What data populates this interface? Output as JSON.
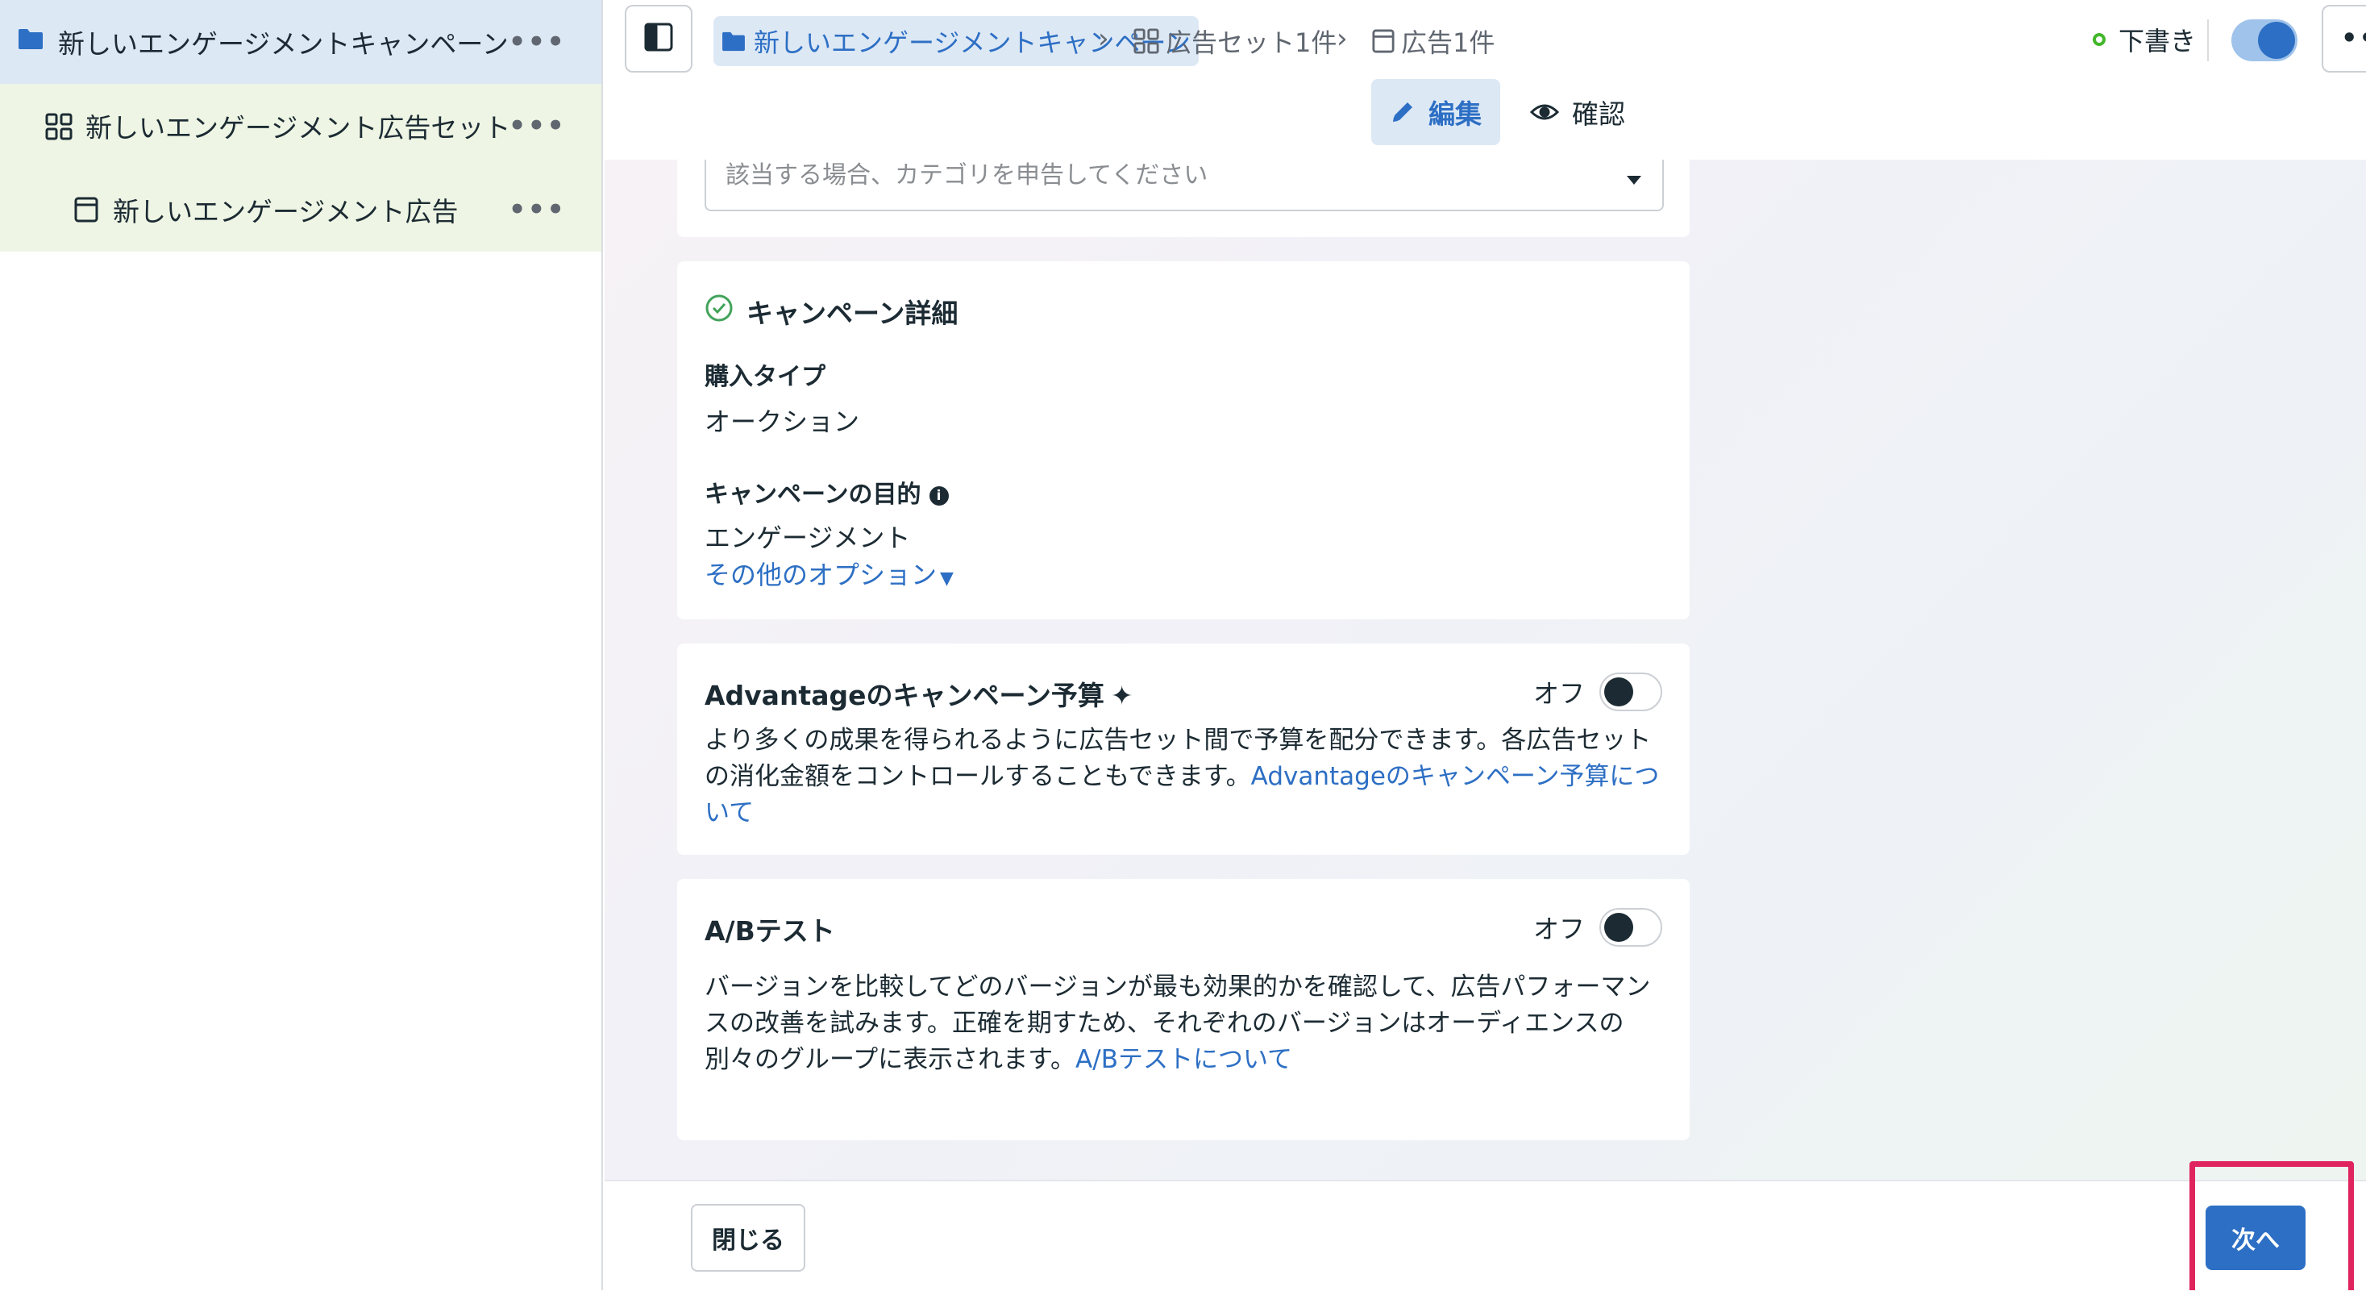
{
  "sidebar": {
    "items": [
      {
        "label": "新しいエンゲージメントキャンペーン",
        "icon": "folder-icon",
        "more": "•••"
      },
      {
        "label": "新しいエンゲージメント広告セット",
        "icon": "grid-icon",
        "more": "•••"
      },
      {
        "label": "新しいエンゲージメント広告",
        "icon": "ad-icon",
        "more": "•••"
      }
    ]
  },
  "header": {
    "breadcrumb": {
      "campaign": "新しいエンゲージメントキャンペーン",
      "adset": "広告セット1件",
      "ad": "広告1件",
      "separator": "›"
    },
    "status": "下書き",
    "more": "•••",
    "tabs": {
      "edit": "編集",
      "review": "確認"
    }
  },
  "main": {
    "category_dropdown": {
      "placeholder": "該当する場合、カテゴリを申告してください"
    },
    "campaign_details": {
      "title": "キャンペーン詳細",
      "purchase_type_label": "購入タイプ",
      "purchase_type_value": "オークション",
      "objective_label": "キャンペーンの目的",
      "objective_value": "エンゲージメント",
      "more_options": "その他のオプション"
    },
    "advantage_budget": {
      "title": "Advantageのキャンペーン予算",
      "toggle_label": "オフ",
      "description": "より多くの成果を得られるように広告セット間で予算を配分できます。各広告セットの消化金額をコントロールすることもできます。",
      "link": "Advantageのキャンペーン予算について"
    },
    "ab_test": {
      "title": "A/Bテスト",
      "toggle_label": "オフ",
      "description": "バージョンを比較してどのバージョンが最も効果的かを確認して、広告パフォーマンスの改善を試みます。正確を期すため、それぞれのバージョンはオーディエンスの別々のグループに表示されます。",
      "link": "A/Bテストについて"
    }
  },
  "footer": {
    "close_label": "閉じる",
    "next_label": "次へ"
  },
  "colors": {
    "accent": "#2d6fc4",
    "highlight": "#e0245e",
    "status_green": "#42b72a"
  }
}
